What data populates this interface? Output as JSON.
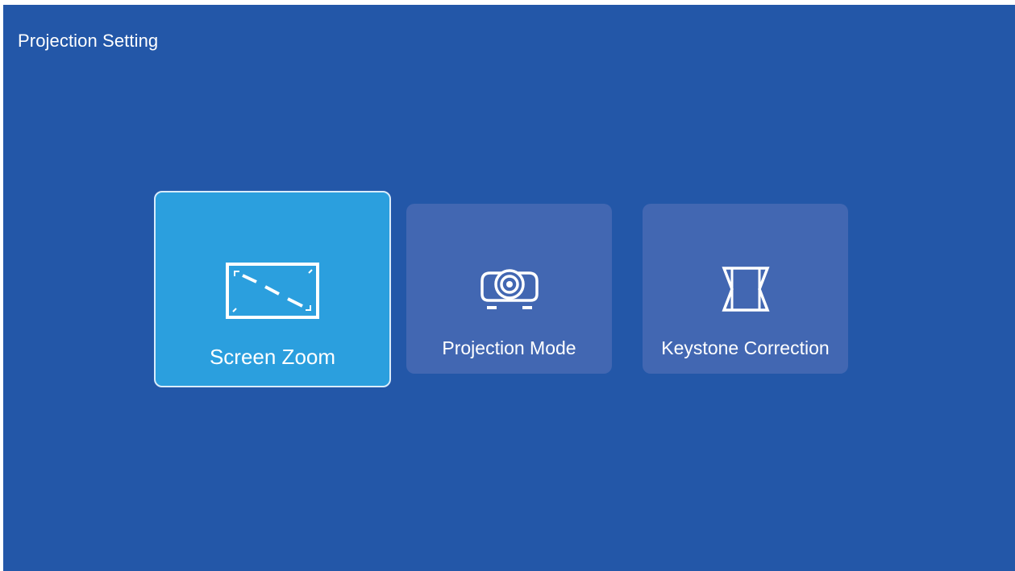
{
  "header": {
    "title": "Projection Setting"
  },
  "menu": {
    "items": [
      {
        "label": "Screen Zoom",
        "icon": "screen-zoom-icon",
        "selected": true
      },
      {
        "label": "Projection Mode",
        "icon": "projector-icon",
        "selected": false
      },
      {
        "label": "Keystone Correction",
        "icon": "keystone-icon",
        "selected": false
      }
    ]
  },
  "colors": {
    "background": "#2357a8",
    "selected_tile": "#2b9fde",
    "tile": "#4267b2",
    "text": "#ffffff"
  }
}
